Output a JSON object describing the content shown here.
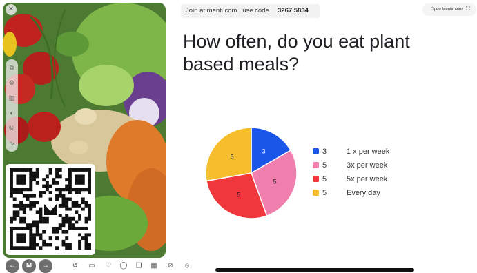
{
  "header": {
    "join_text": "Join at menti.com | use code",
    "join_code": "3267 5834",
    "open_button": "Open Mentimeter"
  },
  "question": {
    "title": "How often, do you eat plant based meals?"
  },
  "chart_data": {
    "type": "pie",
    "categories": [
      "1 x per week",
      "3x per week",
      "5x per week",
      "Every day"
    ],
    "values": [
      3,
      5,
      5,
      5
    ],
    "colors": [
      "#1a57e8",
      "#f07fae",
      "#f0373d",
      "#f6bd2c"
    ],
    "slice_labels": [
      "3",
      "5",
      "5",
      "5"
    ],
    "legend_placement": "right"
  },
  "icons": {
    "close": "close-icon",
    "toolbar": [
      "copy-icon",
      "settings-icon",
      "bar-chart-icon",
      "palette-icon",
      "percent-icon",
      "line-chart-icon"
    ],
    "bottom_left": [
      "back-icon",
      "menti-logo-icon",
      "forward-icon"
    ],
    "bottom_tools": [
      "undo-icon",
      "slide-icon",
      "reaction-icon",
      "comment-icon",
      "qa-icon",
      "grid-icon",
      "hide-icon",
      "block-icon"
    ]
  }
}
